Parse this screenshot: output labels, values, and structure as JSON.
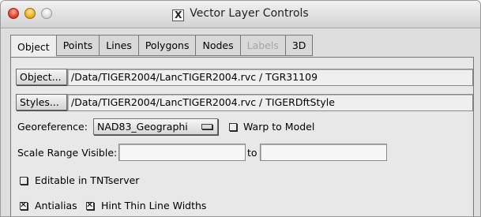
{
  "window": {
    "title": "Vector Layer Controls",
    "x_icon_glyph": "X"
  },
  "tabs": [
    {
      "label": "Object",
      "active": true,
      "disabled": false
    },
    {
      "label": "Points",
      "active": false,
      "disabled": false
    },
    {
      "label": "Lines",
      "active": false,
      "disabled": false
    },
    {
      "label": "Polygons",
      "active": false,
      "disabled": false
    },
    {
      "label": "Nodes",
      "active": false,
      "disabled": false
    },
    {
      "label": "Labels",
      "active": false,
      "disabled": true
    },
    {
      "label": "3D",
      "active": false,
      "disabled": false
    }
  ],
  "object_row": {
    "button_label": "Object...",
    "path": "/Data/TIGER2004/LancTIGER2004.rvc / TGR31109"
  },
  "styles_row": {
    "button_label": "Styles...",
    "path": "/Data/TIGER2004/LancTIGER2004.rvc / TIGERDftStyle"
  },
  "georeference": {
    "label": "Georeference:",
    "value": "NAD83_Geographi"
  },
  "warp_to_model": {
    "label": "Warp to Model",
    "checked": false
  },
  "scale_range": {
    "label": "Scale Range Visible:",
    "from_value": "",
    "to_label": "to",
    "to_value": ""
  },
  "editable": {
    "label": "Editable in TNTserver",
    "checked": false
  },
  "antialias": {
    "label": "Antialias",
    "checked": true
  },
  "hint_thin": {
    "label": "Hint Thin Line Widths",
    "checked": true
  },
  "colors": {
    "background": "#dedede",
    "panel": "#e8e8e8",
    "close": "#e0402a",
    "minimize": "#f0b020"
  }
}
